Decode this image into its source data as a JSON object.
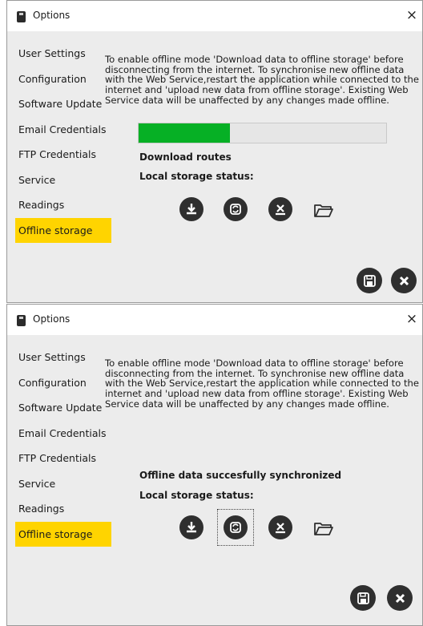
{
  "window": {
    "title": "Options",
    "close_glyph": "×"
  },
  "sidebar": {
    "items": [
      {
        "label": "User Settings"
      },
      {
        "label": "Configuration"
      },
      {
        "label": "Software Update"
      },
      {
        "label": "Email Credentials"
      },
      {
        "label": "FTP Credentials"
      },
      {
        "label": "Service"
      },
      {
        "label": "Readings"
      },
      {
        "label": "Offline storage",
        "selected": true
      }
    ]
  },
  "info": {
    "text": "To enable offline mode 'Download data to offline storage' before disconnecting from the internet. To synchronise new offline data with the Web Service,restart the application while connected to the internet and 'upload new data from offline storage'. Existing Web Service data will be unaffected by any changes made offline."
  },
  "screen1": {
    "progress_fraction": 0.37,
    "status_text": "Download routes",
    "local_storage_label": "Local storage status:"
  },
  "screen2": {
    "status_text": "Offline data succesfully synchronized",
    "local_storage_label": "Local storage status:",
    "focused_action": "sync"
  },
  "actions": [
    {
      "icon": "download-icon"
    },
    {
      "icon": "sync-icon"
    },
    {
      "icon": "delete-icon"
    },
    {
      "icon": "folder-open-icon"
    }
  ],
  "footer": [
    {
      "icon": "save-icon"
    },
    {
      "icon": "close-circle-icon"
    }
  ],
  "colors": {
    "selected": "#ffd400",
    "progress": "#06b025",
    "button": "#2f2f2f"
  }
}
